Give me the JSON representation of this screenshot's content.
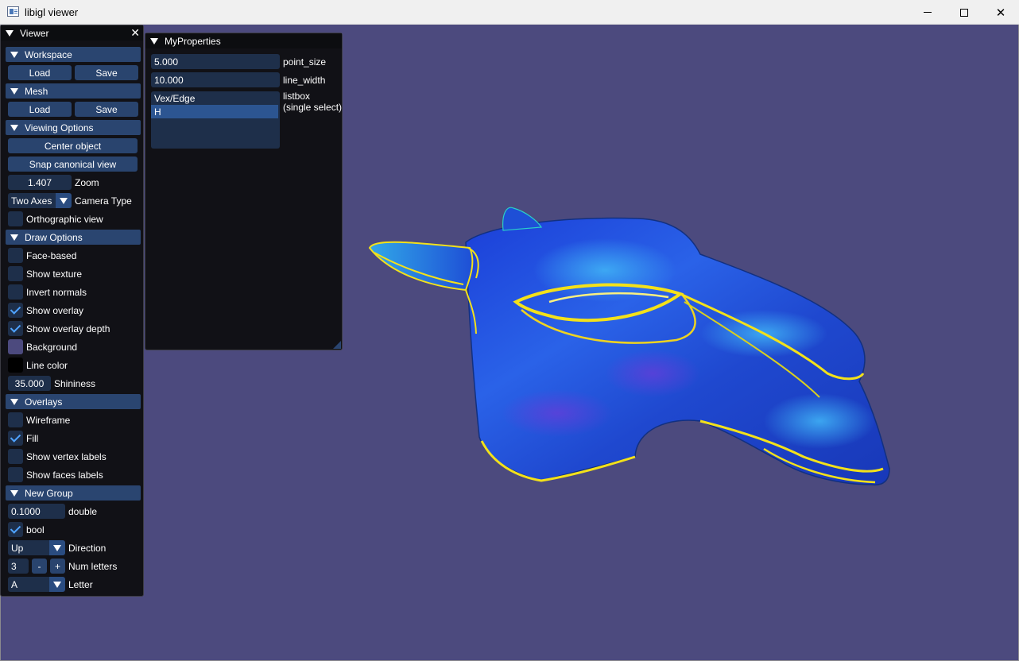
{
  "window": {
    "title": "libigl viewer",
    "controls": {
      "minimize": "─",
      "maximize": "☐",
      "close": "✕"
    }
  },
  "viewer": {
    "title": "Viewer",
    "close_glyph": "✕",
    "workspace": {
      "header": "Workspace",
      "load": "Load",
      "save": "Save"
    },
    "mesh": {
      "header": "Mesh",
      "load": "Load",
      "save": "Save"
    },
    "viewing_options": {
      "header": "Viewing Options",
      "center_object": "Center object",
      "snap_canonical": "Snap canonical view",
      "zoom_value": "1.407",
      "zoom_label": "Zoom",
      "camera_type_value": "Two Axes",
      "camera_type_label": "Camera Type",
      "orthographic_label": "Orthographic view",
      "orthographic_checked": false
    },
    "draw_options": {
      "header": "Draw Options",
      "face_based": "Face-based",
      "show_texture": "Show texture",
      "invert_normals": "Invert normals",
      "show_overlay": "Show overlay",
      "show_overlay_depth": "Show overlay depth",
      "background": "Background",
      "line_color": "Line color",
      "shininess_value": "35.000",
      "shininess_label": "Shininess",
      "background_color": "#4c4a7e",
      "line_color_value": "#000000"
    },
    "overlays": {
      "header": "Overlays",
      "wireframe": "Wireframe",
      "fill": "Fill",
      "show_vertex_labels": "Show vertex labels",
      "show_faces_labels": "Show faces labels"
    },
    "new_group": {
      "header": "New Group",
      "double_value": "0.1000",
      "double_label": "double",
      "bool_label": "bool",
      "direction_value": "Up",
      "direction_label": "Direction",
      "num_letters_value": "3",
      "minus": "-",
      "plus": "+",
      "num_letters_label": "Num letters",
      "letter_value": "A",
      "letter_label": "Letter"
    }
  },
  "my_properties": {
    "title": "MyProperties",
    "point_size_value": "5.000",
    "point_size_label": "point_size",
    "line_width_value": "10.000",
    "line_width_label": "line_width",
    "listbox_items": [
      "Vex/Edge",
      "H"
    ],
    "listbox_selected": "H",
    "listbox_label_1": "listbox",
    "listbox_label_2": "(single select)"
  },
  "colors": {
    "viewport_bg": "#4c4a7e",
    "header_bg": "#2a4570",
    "button_bg": "#29446e",
    "field_bg": "#1e2f4a",
    "check_mark": "#4fa3ff"
  }
}
